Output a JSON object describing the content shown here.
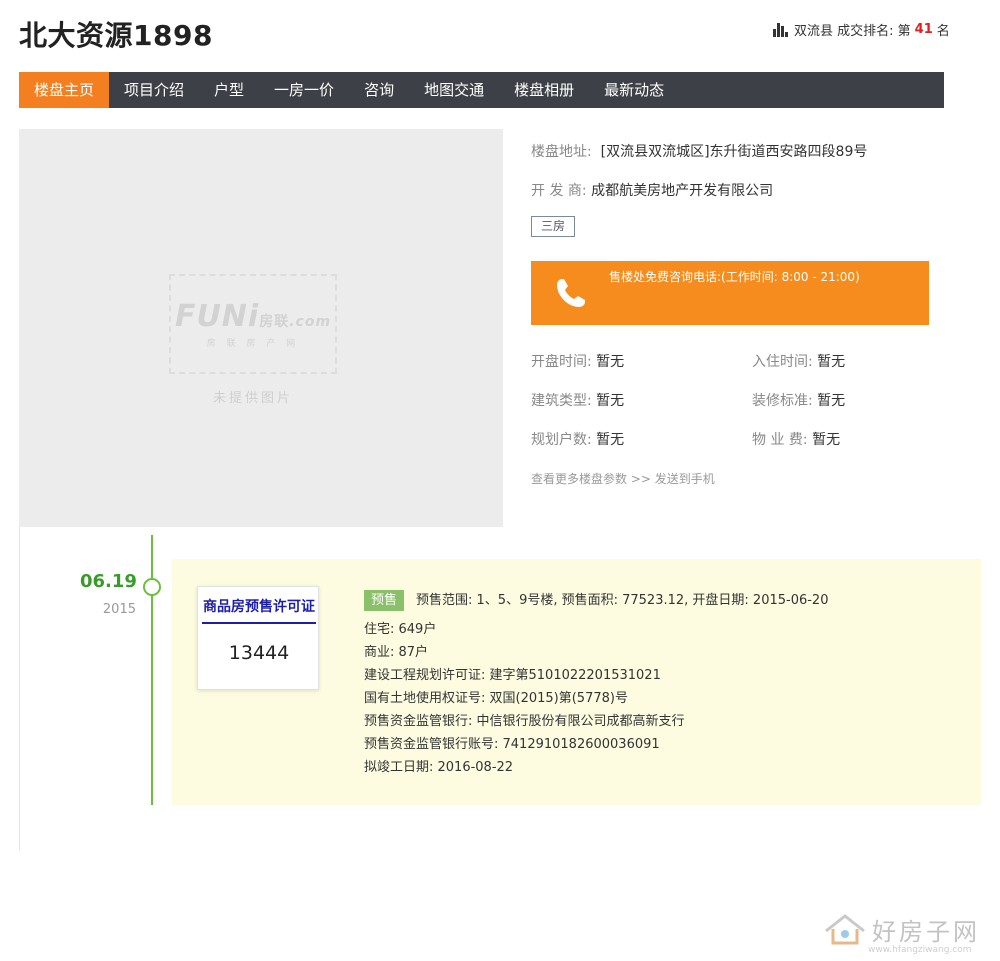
{
  "header": {
    "title": "北大资源1898",
    "rank_prefix": "双流县 成交排名: 第",
    "rank_num": "41",
    "rank_suffix": "名"
  },
  "nav": {
    "items": [
      {
        "label": "楼盘主页"
      },
      {
        "label": "项目介绍"
      },
      {
        "label": "户型"
      },
      {
        "label": "一房一价"
      },
      {
        "label": "咨询"
      },
      {
        "label": "地图交通"
      },
      {
        "label": "楼盘相册"
      },
      {
        "label": "最新动态"
      }
    ]
  },
  "photo": {
    "logo": "FUNi",
    "logo_small": "房联",
    "logo_domain": ".com",
    "logo_sub": "房 联 房 产 网",
    "no_photo": "未提供图片"
  },
  "info": {
    "address_label": "楼盘地址:",
    "address": "[双流县双流城区]东升街道西安路四段89号",
    "developer_label": "开 发 商:",
    "developer": "成都航美房地产开发有限公司",
    "tag": "三房",
    "phone_text": "售楼处免费咨询电话:(工作时间: 8:00 - 21:00)"
  },
  "params": {
    "open_label": "开盘时间:",
    "open": "暂无",
    "checkin_label": "入住时间:",
    "checkin": "暂无",
    "type_label": "建筑类型:",
    "type": "暂无",
    "deco_label": "装修标准:",
    "deco": "暂无",
    "units_label": "规划户数:",
    "units": "暂无",
    "fee_label": "物 业 费:",
    "fee": "暂无",
    "more": "查看更多楼盘参数",
    "sep": ">>",
    "send": "发送到手机"
  },
  "timeline": {
    "date": "06.19",
    "year": "2015",
    "card_title": "商品房预售许可证",
    "card_num": "13444",
    "badge": "预售",
    "line1": "预售范围: 1、5、9号楼, 预售面积: 77523.12, 开盘日期: 2015-06-20",
    "line2": "住宅: 649户",
    "line3": "商业: 87户",
    "line4": "建设工程规划许可证: 建字第5101022201531021",
    "line5": "国有土地使用权证号: 双国(2015)第(5778)号",
    "line6": "预售资金监管银行: 中信银行股份有限公司成都高新支行",
    "line7": "预售资金监管银行账号: 7412910182600036091",
    "line8": "拟竣工日期: 2016-08-22"
  },
  "watermark": {
    "text": "好房子网",
    "url": "www.hfangziwang.com"
  },
  "colors": {
    "nav_bg": "#3d4147",
    "accent_orange": "#f47f20",
    "timeline_green": "#6cbf3c",
    "event_bg": "#fdfce1",
    "card_blue": "#1e1fa8"
  }
}
